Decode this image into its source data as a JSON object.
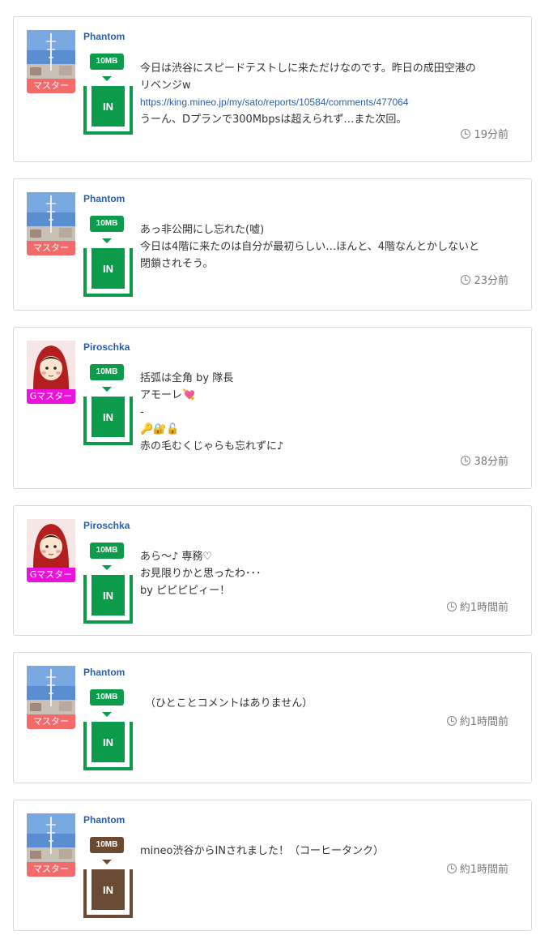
{
  "colors": {
    "green": "#0c9b4b",
    "brown": "#6b4a33",
    "master_badge": "#f26a6a",
    "gmaster_badge": "#ee11dd",
    "link": "#2a5fa8"
  },
  "posts": [
    {
      "user": "Phantom",
      "badge": "マスター",
      "avatar": "tower-photo",
      "amount": "10MB",
      "tank_label": "IN",
      "tank_color": "green",
      "lines": [
        "今日は渋谷にスピードテストしに来ただけなのです。昨日の成田空港の",
        "リベンジw"
      ],
      "link": "https://king.mineo.jp/my/sato/reports/10584/comments/477064",
      "after_link": "うーん、Dプランで300Mbpsは超えられず…また次回。",
      "time": "19分前"
    },
    {
      "user": "Phantom",
      "badge": "マスター",
      "avatar": "tower-photo",
      "amount": "10MB",
      "tank_label": "IN",
      "tank_color": "green",
      "lines": [
        "あっ非公開にし忘れた(嘘)",
        "今日は4階に来たのは自分が最初らしい…ほんと、4階なんとかしないと",
        "閉鎖されそう。"
      ],
      "time": "23分前"
    },
    {
      "user": "Piroschka",
      "badge": "Gマスター",
      "avatar": "red-hood-girl",
      "amount": "10MB",
      "tank_label": "IN",
      "tank_color": "green",
      "lines": [
        "括弧は全角 by 隊長",
        "アモーレ💘",
        "-",
        "🔑🔐🔓",
        "赤の毛むくじゃらも忘れずに♪"
      ],
      "time": "38分前"
    },
    {
      "user": "Piroschka",
      "badge": "Gマスター",
      "avatar": "red-hood-girl",
      "amount": "10MB",
      "tank_label": "IN",
      "tank_color": "green",
      "lines": [
        "あら〜♪ 専務♡",
        "お見限りかと思ったわ･･･",
        "by ピピピピィー！"
      ],
      "time": "約1時間前"
    },
    {
      "user": "Phantom",
      "badge": "マスター",
      "avatar": "tower-photo",
      "amount": "10MB",
      "tank_label": "IN",
      "tank_color": "green",
      "lines": [
        "（ひとことコメントはありません）"
      ],
      "time": "約1時間前"
    },
    {
      "user": "Phantom",
      "badge": "マスター",
      "avatar": "tower-photo",
      "amount": "10MB",
      "tank_label": "IN",
      "tank_color": "brown",
      "lines": [
        "mineo渋谷からINされました！（コーヒータンク）"
      ],
      "time": "約1時間前"
    }
  ]
}
